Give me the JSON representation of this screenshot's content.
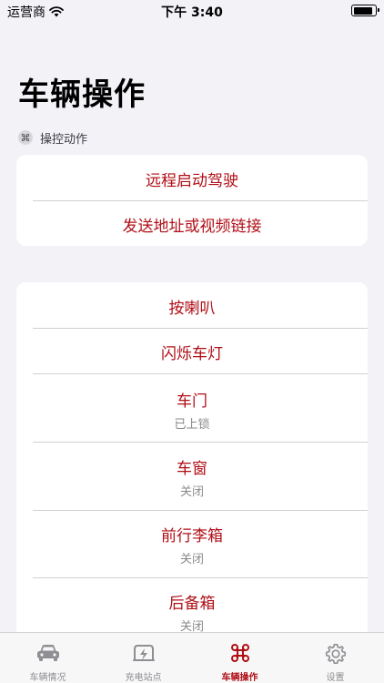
{
  "status_bar": {
    "carrier": "运营商",
    "time": "下午 3:40",
    "battery_level": 0.9
  },
  "page": {
    "title": "车辆操作"
  },
  "section": {
    "header": "操控动作"
  },
  "group1": {
    "items": [
      {
        "title": "远程启动驾驶"
      },
      {
        "title": "发送地址或视频链接"
      }
    ]
  },
  "group2": {
    "items": [
      {
        "title": "按喇叭"
      },
      {
        "title": "闪烁车灯"
      },
      {
        "title": "车门",
        "subtitle": "已上锁"
      },
      {
        "title": "车窗",
        "subtitle": "关闭"
      },
      {
        "title": "前行李箱",
        "subtitle": "关闭"
      },
      {
        "title": "后备箱",
        "subtitle": "关闭"
      }
    ]
  },
  "tabs": [
    {
      "label": "车辆情况",
      "icon": "car-icon"
    },
    {
      "label": "充电站点",
      "icon": "charging-station-icon"
    },
    {
      "label": "车辆操作",
      "icon": "command-icon",
      "active": true
    },
    {
      "label": "设置",
      "icon": "gear-icon"
    }
  ],
  "colors": {
    "accent": "#b00e16",
    "background": "#f2f2f7",
    "inactive_tab": "#8e8e93"
  }
}
